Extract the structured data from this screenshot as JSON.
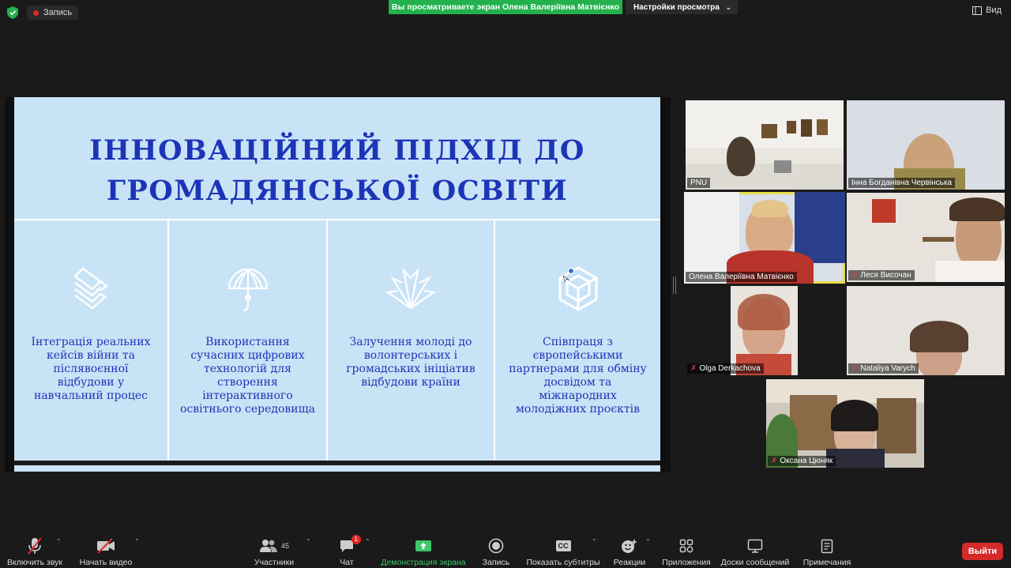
{
  "top": {
    "record_label": "Запись",
    "share_banner": "Вы просматриваете экран Олена Валеріївна Матвієнко",
    "view_settings": "Настройки просмотра",
    "view_button": "Вид"
  },
  "slide": {
    "title_line1": "ІННОВАЦІЙНИЙ ПІДХІД ДО",
    "title_line2": "ГРОМАДЯНСЬКОЇ ОСВІТИ",
    "columns": [
      {
        "text": "Інтеграція реальних кейсів війни та післявоєнної відбудови у навчальний процес"
      },
      {
        "text": "Використання сучасних цифрових технологій для створення інтерактивного освітнього середовища"
      },
      {
        "text": "Залучення молоді до волонтерських і громадських ініціатив відбудови країни"
      },
      {
        "text": "Співпраця з європейськими партнерами для обміну досвідом та міжнародних молодіжних проєктів"
      }
    ]
  },
  "participants": [
    {
      "name": "PNU",
      "muted": false
    },
    {
      "name": "Інна Богданівна Червінська",
      "muted": false
    },
    {
      "name": "Олена Валеріївна Матвієнко",
      "muted": false,
      "active": true
    },
    {
      "name": "Леся Височан",
      "muted": true
    },
    {
      "name": "Olga Derkachova",
      "muted": true
    },
    {
      "name": "Nataliya Varych",
      "muted": true
    },
    {
      "name": "Оксана Цюняк",
      "muted": true
    }
  ],
  "toolbar": {
    "audio": "Включить звук",
    "video": "Начать видео",
    "participants": "Участники",
    "participants_count": "45",
    "chat": "Чат",
    "chat_badge": "1",
    "share": "Демонстрация экрана",
    "record": "Запись",
    "captions": "Показать субтитры",
    "captions_icon": "CC",
    "reactions": "Реакции",
    "apps": "Приложения",
    "whiteboards": "Доски сообщений",
    "notes": "Примечания",
    "exit": "Выйти"
  },
  "colors": {
    "accent_green": "#23b14d",
    "slide_bg": "#c9e3f6",
    "slide_text": "#1c35b8",
    "exit_red": "#d42a2a",
    "active_speaker": "#e8e04a"
  }
}
